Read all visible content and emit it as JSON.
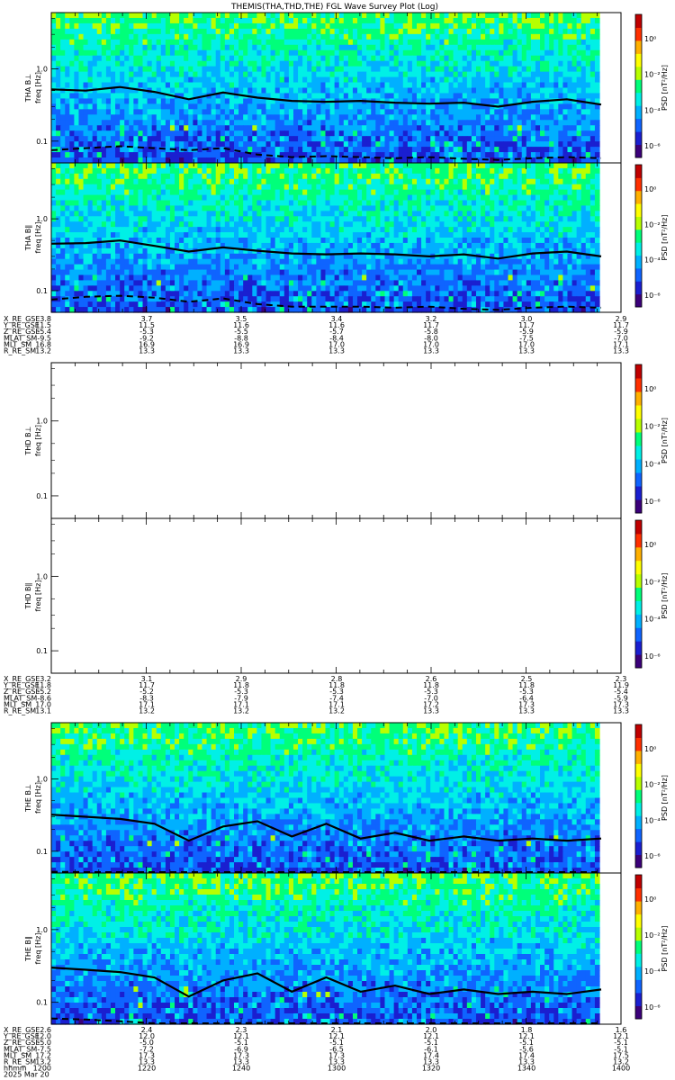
{
  "title": "THEMIS(THA,THD,THE) FGL Wave Survey Plot (Log)",
  "colorbar": {
    "label": "PSD [nT²/Hz]",
    "ticks": [
      "10⁰",
      "10⁻²",
      "10⁻⁴",
      "10⁻⁶"
    ],
    "colors": [
      "#3b007a",
      "#1a1fd0",
      "#0f64ff",
      "#00b0ff",
      "#00f0e6",
      "#00ff7a",
      "#b8ff00",
      "#ffff00",
      "#ffb000",
      "#ff3000",
      "#c00000"
    ]
  },
  "panel_labels": {
    "y_ticks": [
      "1.0",
      "0.1"
    ],
    "freq": "freq [Hz]"
  },
  "chart_data": [
    {
      "type": "heatmap",
      "probe": "THA",
      "component": "B⊥",
      "ylabel": "THA B⊥ freq [Hz]",
      "yscale": "log",
      "ylim": [
        0.05,
        6
      ],
      "has_data": true,
      "fce_solid": [
        0.52,
        0.5,
        0.56,
        0.48,
        0.38,
        0.47,
        0.4,
        0.36,
        0.35,
        0.36,
        0.34,
        0.33,
        0.34,
        0.3,
        0.35,
        0.38,
        0.32
      ],
      "fce_dashed": [
        0.075,
        0.08,
        0.085,
        0.08,
        0.075,
        0.08,
        0.065,
        0.06,
        0.062,
        0.06,
        0.058,
        0.06,
        0.057,
        0.055,
        0.058,
        0.06,
        0.058
      ]
    },
    {
      "type": "heatmap",
      "probe": "THA",
      "component": "B∥",
      "ylabel": "THA B∥ freq [Hz]",
      "yscale": "log",
      "ylim": [
        0.05,
        6
      ],
      "has_data": true,
      "fce_solid": [
        0.45,
        0.46,
        0.5,
        0.42,
        0.35,
        0.4,
        0.36,
        0.33,
        0.32,
        0.33,
        0.32,
        0.3,
        0.32,
        0.28,
        0.33,
        0.35,
        0.3
      ],
      "fce_dashed": [
        0.075,
        0.082,
        0.085,
        0.08,
        0.07,
        0.078,
        0.065,
        0.06,
        0.06,
        0.06,
        0.058,
        0.06,
        0.056,
        0.054,
        0.058,
        0.06,
        0.058
      ]
    },
    {
      "type": "heatmap",
      "probe": "THD",
      "component": "B⊥",
      "ylabel": "THD B⊥ freq [Hz]",
      "yscale": "log",
      "ylim": [
        0.05,
        6
      ],
      "has_data": false
    },
    {
      "type": "heatmap",
      "probe": "THD",
      "component": "B∥",
      "ylabel": "THD B∥ freq [Hz]",
      "yscale": "log",
      "ylim": [
        0.05,
        6
      ],
      "has_data": false
    },
    {
      "type": "heatmap",
      "probe": "THE",
      "component": "B⊥",
      "ylabel": "THE B⊥ freq [Hz]",
      "yscale": "log",
      "ylim": [
        0.05,
        6
      ],
      "has_data": true,
      "fce_solid": [
        0.32,
        0.3,
        0.28,
        0.24,
        0.14,
        0.22,
        0.26,
        0.16,
        0.24,
        0.15,
        0.18,
        0.14,
        0.16,
        0.14,
        0.15,
        0.14,
        0.15
      ],
      "fce_dashed": [
        0.052,
        0.05,
        0.048,
        0.045,
        0.04,
        0.044,
        0.046,
        0.04,
        0.045,
        0.042,
        0.044,
        0.04,
        0.043,
        0.041,
        0.043,
        0.04,
        0.042
      ]
    },
    {
      "type": "heatmap",
      "probe": "THE",
      "component": "B∥",
      "ylabel": "THE B∥ freq [Hz]",
      "yscale": "log",
      "ylim": [
        0.05,
        6
      ],
      "has_data": true,
      "fce_solid": [
        0.3,
        0.28,
        0.26,
        0.22,
        0.12,
        0.2,
        0.25,
        0.14,
        0.22,
        0.14,
        0.17,
        0.13,
        0.15,
        0.13,
        0.14,
        0.13,
        0.15
      ],
      "fce_dashed": [
        0.06,
        0.058,
        0.055,
        0.05,
        0.045,
        0.05,
        0.052,
        0.045,
        0.05,
        0.047,
        0.05,
        0.045,
        0.048,
        0.046,
        0.048,
        0.045,
        0.047
      ]
    }
  ],
  "ephemeris": [
    {
      "labels": [
        "X_RE_GSE",
        "Y_RE_GSE",
        "Z_RE_GSE",
        "MLAT_SM",
        "MLT_SM",
        "R_RE_SM"
      ],
      "columns": [
        [
          "3.8",
          "11.5",
          "-5.4",
          "-9.5",
          "16.8",
          "13.2"
        ],
        [
          "3.7",
          "11.5",
          "-5.3",
          "-9.2",
          "16.9",
          "13.3"
        ],
        [
          "3.5",
          "11.6",
          "-5.5",
          "-8.8",
          "16.9",
          "13.3"
        ],
        [
          "3.4",
          "11.6",
          "-5.7",
          "-8.4",
          "17.0",
          "13.3"
        ],
        [
          "3.2",
          "11.7",
          "-5.8",
          "-8.0",
          "17.0",
          "13.3"
        ],
        [
          "3.0",
          "11.7",
          "-5.9",
          "-7.5",
          "17.0",
          "13.3"
        ],
        [
          "2.9",
          "11.7",
          "-5.9",
          "-7.0",
          "17.1",
          "13.3"
        ]
      ]
    },
    {
      "labels": [
        "X_RE_GSE",
        "Y_RE_GSE",
        "Z_RE_GSE",
        "MLAT_SM",
        "MLT_SM",
        "R_RE_SM"
      ],
      "columns": [
        [
          "3.2",
          "11.8",
          "-5.2",
          "-8.6",
          "17.0",
          "13.1"
        ],
        [
          "3.1",
          "11.7",
          "-5.2",
          "-8.3",
          "17.1",
          "13.2"
        ],
        [
          "2.9",
          "11.8",
          "-5.3",
          "-7.9",
          "17.1",
          "13.2"
        ],
        [
          "2.8",
          "11.8",
          "-5.3",
          "-7.4",
          "17.1",
          "13.2"
        ],
        [
          "2.6",
          "11.8",
          "-5.3",
          "-7.0",
          "17.2",
          "13.3"
        ],
        [
          "2.5",
          "11.8",
          "-5.3",
          "-6.4",
          "17.3",
          "13.3"
        ],
        [
          "2.3",
          "11.9",
          "-5.4",
          "-5.9",
          "17.3",
          "13.3"
        ]
      ]
    },
    {
      "labels": [
        "X_RE_GSE",
        "Y_RE_GSE",
        "Z_RE_GSE",
        "MLAT_SM",
        "MLT_SM",
        "R_RE_SM",
        "hhmm",
        "2025 Mar 20"
      ],
      "columns": [
        [
          "2.6",
          "12.0",
          "-5.0",
          "-7.5",
          "17.2",
          "13.2",
          "1200"
        ],
        [
          "2.4",
          "12.0",
          "-5.0",
          "-7.2",
          "17.3",
          "13.3",
          "1220"
        ],
        [
          "2.3",
          "12.1",
          "-5.1",
          "-6.9",
          "17.3",
          "13.3",
          "1240"
        ],
        [
          "2.1",
          "12.1",
          "-5.1",
          "-6.5",
          "17.3",
          "13.3",
          "1300"
        ],
        [
          "2.0",
          "12.1",
          "-5.1",
          "-6.1",
          "17.4",
          "13.3",
          "1320"
        ],
        [
          "1.8",
          "12.1",
          "-5.1",
          "-5.6",
          "17.4",
          "13.3",
          "1340"
        ],
        [
          "1.6",
          "12.1",
          "-5.1",
          "-5.1",
          "17.5",
          "13.2",
          "1400"
        ]
      ]
    }
  ]
}
